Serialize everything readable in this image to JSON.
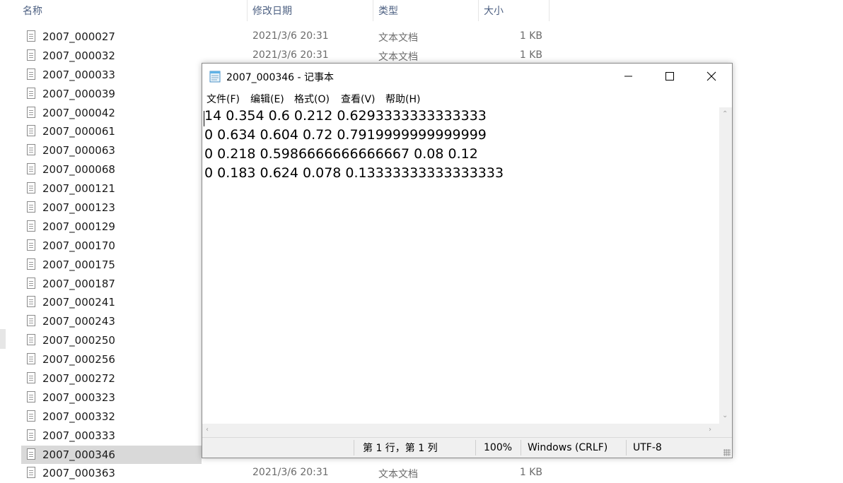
{
  "explorer": {
    "columns": {
      "name": "名称",
      "modified": "修改日期",
      "type": "类型",
      "size": "大小"
    },
    "files": [
      {
        "name": "2007_000027",
        "date": "2021/3/6 20:31",
        "type": "文本文档",
        "size": "1 KB"
      },
      {
        "name": "2007_000032",
        "date": "2021/3/6 20:31",
        "type": "文本文档",
        "size": "1 KB"
      },
      {
        "name": "2007_000033",
        "date": "",
        "type": "",
        "size": ""
      },
      {
        "name": "2007_000039",
        "date": "",
        "type": "",
        "size": ""
      },
      {
        "name": "2007_000042",
        "date": "",
        "type": "",
        "size": ""
      },
      {
        "name": "2007_000061",
        "date": "",
        "type": "",
        "size": ""
      },
      {
        "name": "2007_000063",
        "date": "",
        "type": "",
        "size": ""
      },
      {
        "name": "2007_000068",
        "date": "",
        "type": "",
        "size": ""
      },
      {
        "name": "2007_000121",
        "date": "",
        "type": "",
        "size": ""
      },
      {
        "name": "2007_000123",
        "date": "",
        "type": "",
        "size": ""
      },
      {
        "name": "2007_000129",
        "date": "",
        "type": "",
        "size": ""
      },
      {
        "name": "2007_000170",
        "date": "",
        "type": "",
        "size": ""
      },
      {
        "name": "2007_000175",
        "date": "",
        "type": "",
        "size": ""
      },
      {
        "name": "2007_000187",
        "date": "",
        "type": "",
        "size": ""
      },
      {
        "name": "2007_000241",
        "date": "",
        "type": "",
        "size": ""
      },
      {
        "name": "2007_000243",
        "date": "",
        "type": "",
        "size": ""
      },
      {
        "name": "2007_000250",
        "date": "",
        "type": "",
        "size": ""
      },
      {
        "name": "2007_000256",
        "date": "",
        "type": "",
        "size": ""
      },
      {
        "name": "2007_000272",
        "date": "",
        "type": "",
        "size": ""
      },
      {
        "name": "2007_000323",
        "date": "",
        "type": "",
        "size": ""
      },
      {
        "name": "2007_000332",
        "date": "",
        "type": "",
        "size": ""
      },
      {
        "name": "2007_000333",
        "date": "",
        "type": "",
        "size": ""
      },
      {
        "name": "2007_000346",
        "date": "",
        "type": "",
        "size": ""
      },
      {
        "name": "2007_000363",
        "date": "2021/3/6 20:31",
        "type": "文本文档",
        "size": "1 KB"
      }
    ]
  },
  "notepad": {
    "title": "2007_000346 - 记事本",
    "menu": [
      "文件(F)",
      "编辑(E)",
      "格式(O)",
      "查看(V)",
      "帮助(H)"
    ],
    "lines": [
      "14 0.354 0.6 0.212 0.6293333333333333",
      "0 0.634 0.604 0.72 0.7919999999999999",
      "0 0.218 0.5986666666666667 0.08 0.12",
      "0 0.183 0.624 0.078 0.13333333333333333"
    ],
    "status": {
      "position": "第 1 行，第 1 列",
      "zoom": "100%",
      "line_ending": "Windows (CRLF)",
      "encoding": "UTF-8"
    }
  },
  "icons": {
    "file": "text-file-icon",
    "notepad": "notepad-icon",
    "minimize": "minimize-icon",
    "maximize": "maximize-icon",
    "close": "close-icon"
  }
}
